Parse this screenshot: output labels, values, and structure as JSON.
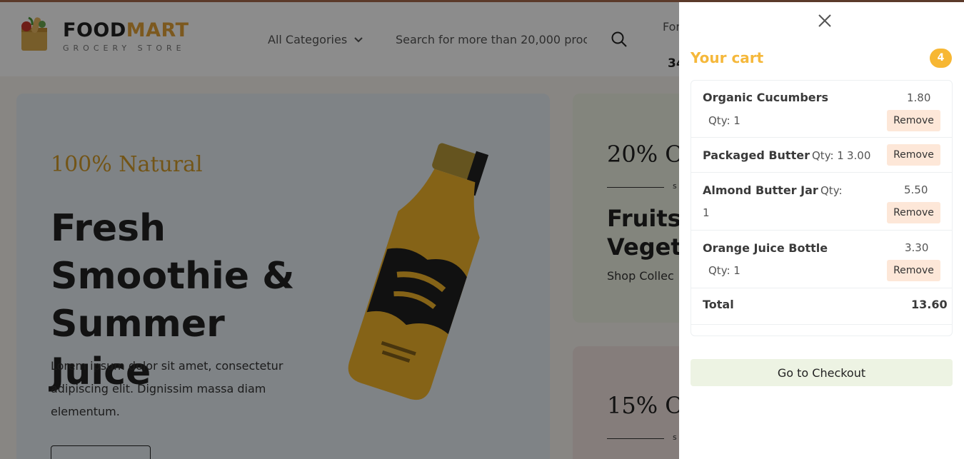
{
  "header": {
    "logo_food": "FOOD",
    "logo_mart": "MART",
    "logo_sub": "GROCERY STORE",
    "categories_label": "All Categories",
    "search_placeholder": "Search for more than 20,000 proc",
    "for_text": "For",
    "phone_text": "34"
  },
  "hero": {
    "tag": "100% Natural",
    "title": "Fresh Smoothie & Summer Juice",
    "description": "Lorem ipsum dolor sit amet, consectetur adipiscing elit. Dignissim massa diam elementum."
  },
  "promos": [
    {
      "off": "20% O",
      "s": "s",
      "title_line1": "Fruits",
      "title_line2": "Vegeta",
      "shop": "Shop Collec"
    },
    {
      "off": "15% O",
      "s": "s"
    }
  ],
  "cart": {
    "title": "Your cart",
    "count": "4",
    "remove_label": "Remove",
    "items": [
      {
        "name": "Organic Cucumbers",
        "qty": "Qty: 1",
        "price": "1.80"
      },
      {
        "name": "Packaged Butter",
        "qty": "Qty: 1",
        "price": "3.00"
      },
      {
        "name": "Almond Butter Jar",
        "qty": "Qty:",
        "qty_num": "1",
        "price": "5.50"
      },
      {
        "name": "Orange Juice Bottle",
        "qty": "Qty: 1",
        "price": "3.30"
      }
    ],
    "total_label": "Total",
    "total_value": "13.60",
    "checkout_label": "Go to Checkout"
  },
  "colors": {
    "accent": "#f5b83b",
    "brand_mart": "#e2a23a",
    "remove_bg": "#fde7d8",
    "checkout_bg": "#edf3e3"
  }
}
